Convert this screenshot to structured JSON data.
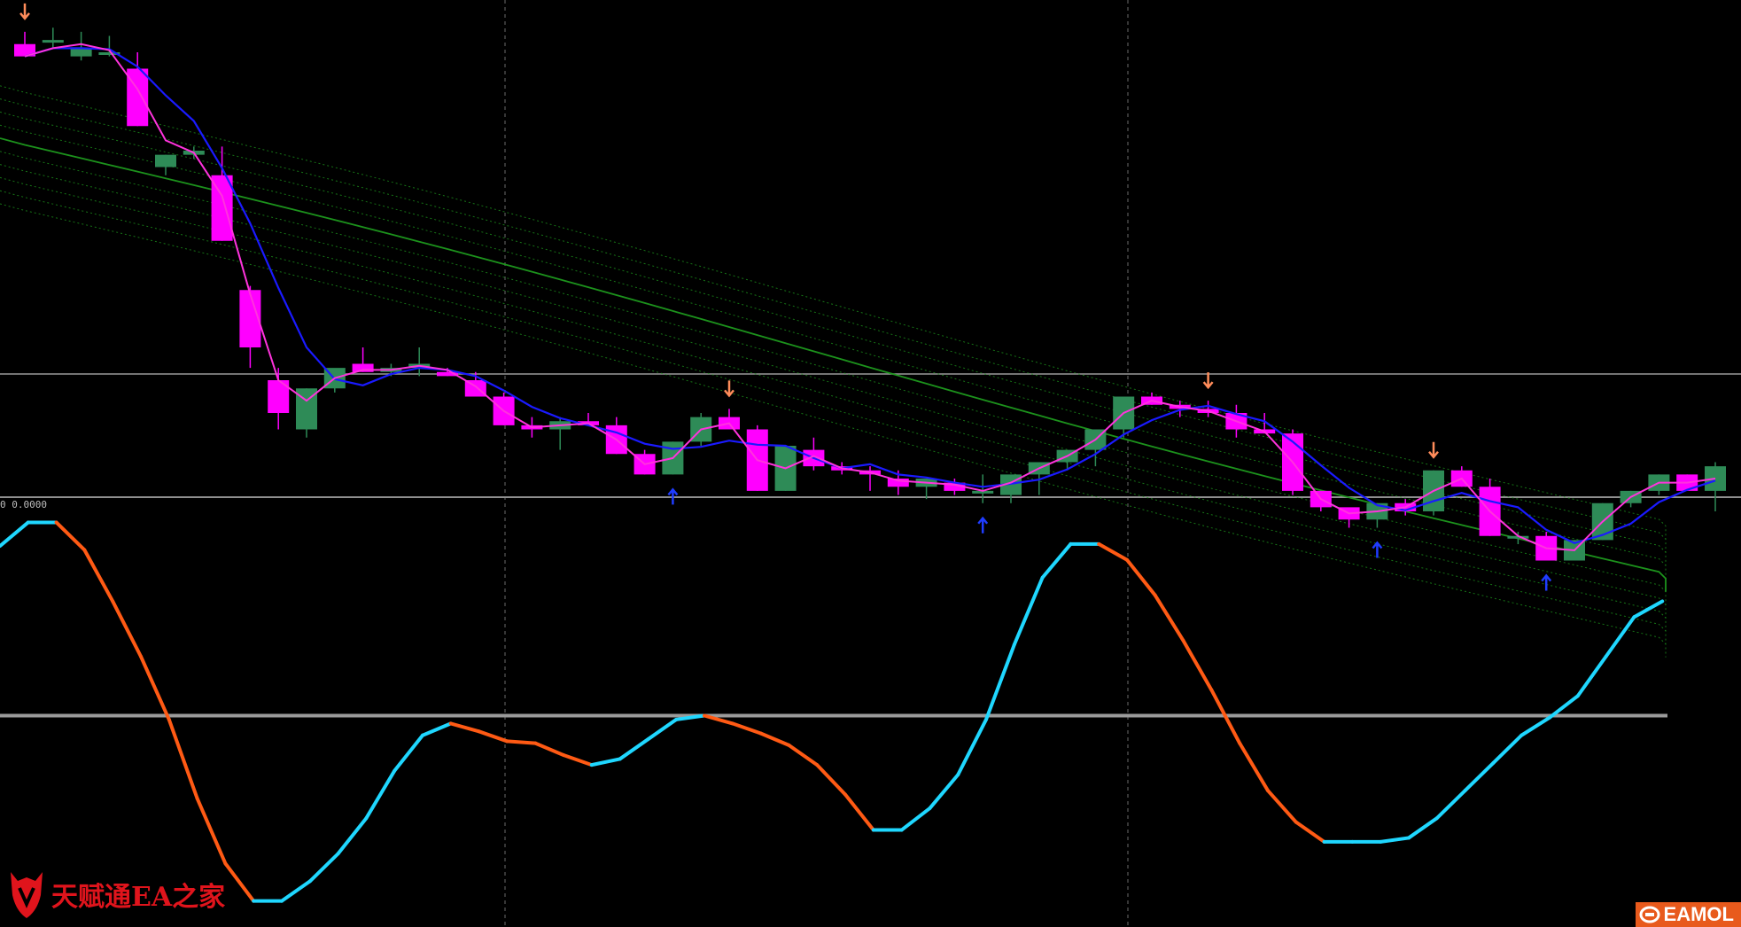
{
  "chart_data": {
    "type": "candlestick",
    "price_panel": {
      "ylim": [
        0,
        56
      ],
      "ohlc": [
        [
          53,
          54.5,
          52.5,
          51.5
        ],
        [
          53.5,
          55,
          52.5,
          53.5
        ],
        [
          51.5,
          54.5,
          51,
          52.5
        ],
        [
          52,
          54,
          51.5,
          52
        ],
        [
          50,
          52,
          48,
          43
        ],
        [
          38,
          39.5,
          37,
          39.5
        ],
        [
          39.5,
          40.5,
          39,
          40
        ],
        [
          37,
          40.5,
          37,
          29
        ],
        [
          23,
          23.5,
          13.5,
          16
        ],
        [
          12,
          13.5,
          6,
          8
        ],
        [
          6,
          11,
          5,
          11
        ],
        [
          11,
          12.5,
          10.5,
          13.5
        ],
        [
          14,
          16,
          13.5,
          13
        ],
        [
          13,
          14,
          12.5,
          13.5
        ],
        [
          13.5,
          16,
          12.5,
          14
        ],
        [
          13,
          13.5,
          12.5,
          12.5
        ],
        [
          12,
          13,
          10.5,
          10
        ],
        [
          10,
          10.5,
          7.5,
          6.5
        ],
        [
          6.5,
          7.5,
          5,
          6
        ],
        [
          6,
          7.5,
          3.5,
          7
        ],
        [
          7,
          8,
          6.5,
          6.5
        ],
        [
          6.5,
          7.5,
          4.5,
          3
        ],
        [
          3,
          3.5,
          0.5,
          0.5
        ],
        [
          0.5,
          4.5,
          0.5,
          4.5
        ],
        [
          4.5,
          8,
          4,
          7.5
        ],
        [
          7.5,
          8.5,
          6.5,
          6
        ],
        [
          6,
          6.5,
          0,
          -1.5
        ],
        [
          -1.5,
          4,
          -1.5,
          4
        ],
        [
          3.5,
          5,
          1,
          1.5
        ],
        [
          1.5,
          2,
          0.5,
          1
        ],
        [
          1,
          1.5,
          -1.5,
          0.5
        ],
        [
          0,
          1,
          -2,
          -1
        ],
        [
          -1,
          0,
          -2.5,
          0
        ],
        [
          -0.5,
          0,
          -2,
          -1.5
        ],
        [
          -1.5,
          0.5,
          -3,
          -1.5
        ],
        [
          -2,
          -1,
          -3,
          0.5
        ],
        [
          0.5,
          1.5,
          -2,
          2
        ],
        [
          2,
          3,
          1,
          3.5
        ],
        [
          3.5,
          4.5,
          1.5,
          6
        ],
        [
          6,
          10,
          5,
          10
        ],
        [
          10,
          10.5,
          10,
          9
        ],
        [
          9,
          9.5,
          7.5,
          8.5
        ],
        [
          8.5,
          9.5,
          7.5,
          8
        ],
        [
          8,
          9,
          5,
          6
        ],
        [
          6,
          8,
          5.5,
          5.5
        ],
        [
          5.5,
          6,
          -2,
          -1.5
        ],
        [
          -1.5,
          -1.5,
          -4,
          -3.5
        ],
        [
          -3.5,
          -4,
          -6,
          -5
        ],
        [
          -5,
          -3,
          -6,
          -3
        ],
        [
          -3,
          -2.5,
          -4.5,
          -4
        ],
        [
          -4,
          1,
          -4.5,
          1
        ],
        [
          1,
          1.5,
          -1,
          -1
        ],
        [
          -1,
          0,
          -7,
          -7
        ],
        [
          -7,
          -6.5,
          -8,
          -7
        ],
        [
          -7,
          -6.5,
          -10,
          -10
        ],
        [
          -10,
          -7.5,
          -10,
          -7.5
        ],
        [
          -7.5,
          -3,
          -7.5,
          -3
        ],
        [
          -3,
          -1.5,
          -3.5,
          -1.5
        ],
        [
          -1.5,
          0.5,
          -2,
          0.5
        ],
        [
          0.5,
          0.5,
          -1,
          -1.5
        ],
        [
          -1.5,
          2,
          -4,
          1.5
        ]
      ],
      "signal_down_idx": [
        0,
        25,
        42,
        50
      ],
      "signal_up_idx": [
        23,
        34,
        48,
        54
      ],
      "ma_fast_color": "#ff33dd",
      "ma_slow_color": "#1a1aff",
      "band_color": "#1e9a1e",
      "bull_color": "#2e8b57",
      "bear_color": "#ff00ff",
      "arrow_down_color": "#ff8c5a",
      "arrow_up_color": "#1f3cff",
      "hline_color": "#9a9a9a"
    },
    "oscillator": {
      "label": "0 0.0000",
      "ylim": [
        -100,
        100
      ],
      "zero_level": 0,
      "values": [
        86,
        98,
        98,
        84,
        58,
        30,
        -2,
        -42,
        -75,
        -94,
        -94,
        -84,
        -70,
        -52,
        -28,
        -10,
        -4,
        -8,
        -13,
        -14,
        -20,
        -25,
        -22,
        -12,
        -2,
        0,
        -4,
        -9,
        -15,
        -25,
        -40,
        -58,
        -58,
        -47,
        -30,
        -2,
        36,
        70,
        87,
        87,
        79,
        61,
        38,
        13,
        -14,
        -38,
        -54,
        -64,
        -64,
        -64,
        -62,
        -52,
        -38,
        -24,
        -10,
        -1,
        10,
        30,
        50,
        58
      ],
      "up_color": "#1fd7ff",
      "down_color": "#ff5a14",
      "zero_color": "#9a9a9a"
    },
    "watermark": "天赋通EA之家",
    "badge": "EAMOL"
  }
}
